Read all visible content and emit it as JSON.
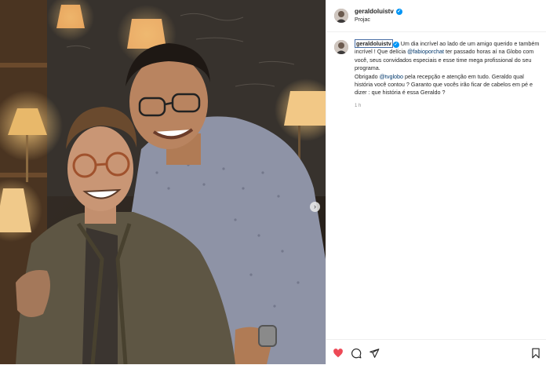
{
  "photo": {
    "alt_left_person": "man with glasses and olive jacket",
    "alt_right_person": "man with glasses and patterned shirt"
  },
  "header": {
    "username": "geraldoluistv",
    "subtitle": "Projac"
  },
  "caption": {
    "username": "geraldoluistv",
    "text_1": " Um dia incrível ao lado de um amigo querido e também incrível ! Que delícia ",
    "mention_1": "@fabioporchat",
    "text_2": " ter passado horas aí na Globo com você, seus convidados especiais e esse time mega profissional do seu programa.",
    "text_3": "Obrigado ",
    "mention_2": "@tvglobo",
    "text_4": " pela recepção e atenção em tudo. Geraldo qual história você contou ? Garanto que vocês irão ficar de cabelos em pé e dizer : que história é essa Geraldo ?",
    "time": "1 h"
  },
  "colors": {
    "verified": "#0095f6",
    "heart": "#ed4956",
    "mention": "#00376b"
  },
  "icons": [
    "heart-icon",
    "comment-icon",
    "share-icon",
    "bookmark-icon"
  ]
}
